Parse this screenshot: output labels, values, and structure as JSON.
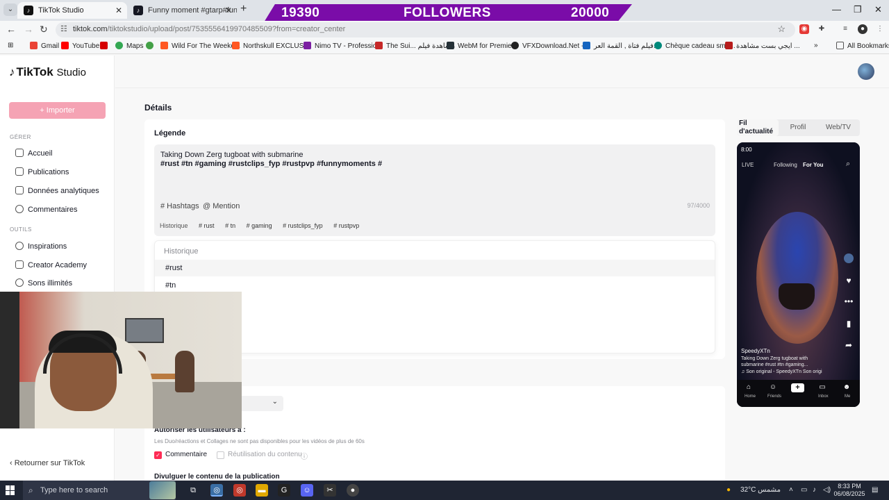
{
  "browser": {
    "tabs": [
      {
        "label": "TikTok Studio",
        "active": true
      },
      {
        "label": "Funny moment #gtarp#funny#",
        "active": false
      }
    ],
    "overlay": {
      "count_left": "19390",
      "label": "FOLLOWERS",
      "count_right": "20000"
    },
    "url_host": "tiktok.com",
    "url_path": "/tiktokstudio/upload/post/7535556419970485509?from=creator_center",
    "bookmarks": [
      "Gmail",
      "YouTube",
      "Maps",
      "Wild For The Weeke...",
      "Northskull EXCLUSI...",
      "Nimo TV - Professio...",
      "The Sui... مشاهدة فيلم",
      "WebM for Premiere",
      "VFXDownload.Net -...",
      "فيلم فتاة , القمة العر...",
      "Chèque cadeau sma...",
      "ايجي بست مشاهدة ...",
      "All Bookmarks"
    ]
  },
  "sidebar": {
    "logo": "TikTok",
    "logo_suffix": "Studio",
    "import_label": "+ Importer",
    "section_manage": "GÉRER",
    "manage_items": [
      "Accueil",
      "Publications",
      "Données analytiques",
      "Commentaires"
    ],
    "section_tools": "OUTILS",
    "tools_items": [
      "Inspirations",
      "Creator Academy",
      "Sons illimités"
    ],
    "back_link": "‹ Retourner sur TikTok"
  },
  "main": {
    "title": "Détails",
    "caption_label": "Légende",
    "caption_line1": "Taking Down Zerg tugboat with submarine",
    "caption_line2": "#rust #tn #gaming #rustclips_fyp  #rustpvp #funnymoments #",
    "hashtags_btn": "# Hashtags",
    "mention_btn": "@ Mention",
    "char_count": "97/4000",
    "history_label": "Historique",
    "history_chips": [
      "# rust",
      "# tn",
      "# gaming",
      "# rustclips_fyp",
      "# rustpvp"
    ],
    "dropdown_title": "Historique",
    "dropdown_items": [
      "#rust",
      "#tn"
    ],
    "allow_title": "Autoriser les utilisateurs à :",
    "allow_note": "Les Duo/réactions et Collages ne sont pas disponibles pour les vidéos de plus de 60s",
    "checkbox_comment": "Commentaire",
    "checkbox_reuse": "Réutilisation du contenu",
    "divulge_title": "Divulguer le contenu de la publication"
  },
  "preview": {
    "tabs": [
      "Fil d'actualité",
      "Profil",
      "Web/TV"
    ],
    "time": "8:00",
    "top_following": "Following",
    "top_for_you": "For You",
    "live": "LIVE",
    "username": "SpeedyXTn",
    "caption": "Taking Down Zerg tugboat with submarine #rust #tn #gaming...",
    "sound": "♫ Son original - SpeedyXTn    Son origi",
    "nav": [
      "Home",
      "Friends",
      "",
      "Inbox",
      "Me"
    ]
  },
  "taskbar": {
    "search_placeholder": "Type here to search",
    "weather": "32°C  مشمس",
    "time": "8:33 PM",
    "date": "06/08/2025"
  }
}
